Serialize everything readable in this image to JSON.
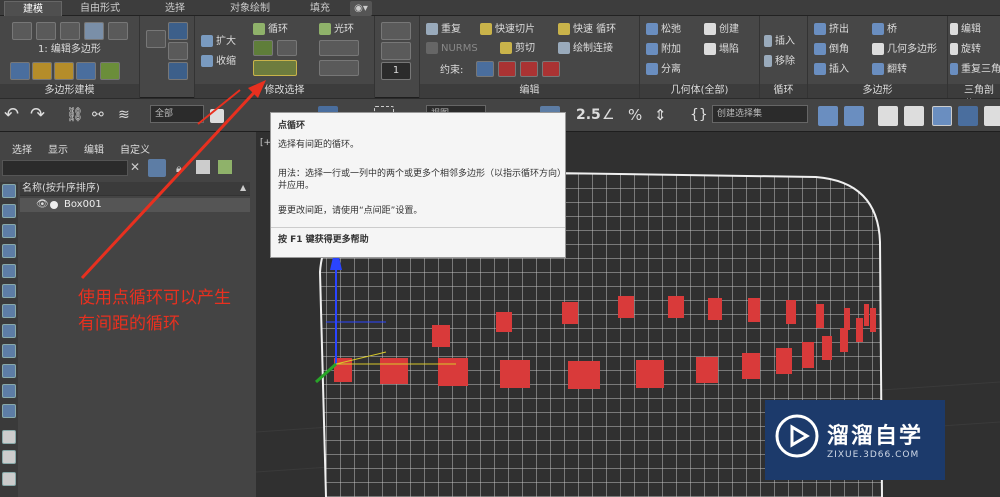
{
  "tabs": [
    {
      "label": "建模",
      "active": true
    },
    {
      "label": "自由形式"
    },
    {
      "label": "选择"
    },
    {
      "label": "对象绘制"
    },
    {
      "label": "填充"
    }
  ],
  "ribbon": {
    "poly_model_label": "多边形建模",
    "edit_poly_label": "1: 编辑多边形",
    "modify_select_label": "修改选择",
    "modify": {
      "grow": "扩大",
      "shrink": "收缩",
      "loop": "循环",
      "ring": "光环"
    },
    "edit": {
      "title": "编辑",
      "repeat": "重复",
      "quickslice": "快速切片",
      "quickloop": "快速 循环",
      "nurms": "NURMS",
      "cut": "剪切",
      "drawconnect": "绘制连接",
      "constraint": "约束:"
    },
    "geometry": {
      "title": "几何体(全部)",
      "relax": "松弛",
      "create": "创建",
      "attach": "附加",
      "collapse": "塌陷",
      "detach": "分离"
    },
    "loops": {
      "title": "循环",
      "insert": "插入",
      "remove": "移除"
    },
    "polygons": {
      "title": "多边形",
      "extrude": "挤出",
      "bridge": "桥",
      "bevel": "倒角",
      "geopoly": "几何多边形",
      "inset": "插入",
      "flip": "翻转"
    },
    "tris": {
      "title": "三角剖分",
      "edit": "编辑",
      "spin": "旋转",
      "retri": "重复三角"
    },
    "spinner_value": "1"
  },
  "toolbar": {
    "selset": "创建选择集",
    "all": "全部",
    "view": "视图",
    "numlabel": "2.5"
  },
  "left_panel": {
    "menu": [
      "选择",
      "显示",
      "编辑",
      "自定义"
    ],
    "sort_header": "名称(按升序排序)",
    "object": "Box001"
  },
  "viewport": {
    "label": "[+]"
  },
  "tooltip": {
    "title": "点循环",
    "desc": "选择有间距的循环。",
    "usage": "用法：选择一行或一列中的两个或更多个相邻多边形（以指示循环方向）并应用。",
    "usage_line1": "用法：选择一行或一列中的两个或更多个相邻多边形（以指示循",
    "usage_line2": "环方向）并应用。",
    "spacing": "要更改间距，请使用“点间距”设置。",
    "help": "按 F1 键获得更多帮助"
  },
  "annotation": {
    "line1": "使用点循环可以产生",
    "line2": "有间距的循环"
  },
  "watermark": {
    "brand": "溜溜自学",
    "site": "ZIXUE.3D66.COM"
  },
  "colors": {
    "accent": "#5d7da5",
    "selected_face": "#d93a3a",
    "annotation": "#e8301f",
    "watermark_bg": "#1c3a6b"
  }
}
